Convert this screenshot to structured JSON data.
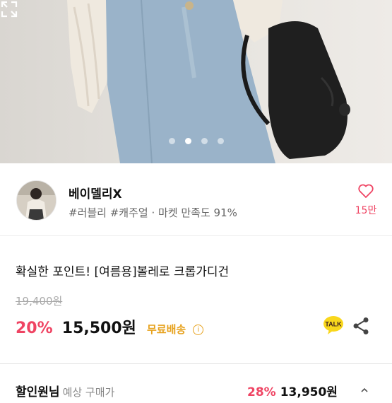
{
  "hero": {
    "dots_count": 4,
    "active_dot_index": 1,
    "expand_icon": "expand-icon"
  },
  "seller": {
    "name": "베이델리X",
    "tags": "#러블리 #캐주얼 · 마켓 만족도 91%",
    "like_icon": "heart-outline-icon",
    "like_count": "15만"
  },
  "product": {
    "title": "확실한 포인트! [여름용]볼레로 크롭가디건",
    "original_price": "19,400원",
    "discount": "20%",
    "price": "15,500원",
    "shipping_badge": "무료배송",
    "info_icon": "info-icon"
  },
  "actions": {
    "talk_label": "TALK",
    "share_icon": "share-icon"
  },
  "next_row": {
    "label": "할인원님",
    "sub": "예상 구매가",
    "discount": "28%",
    "price": "13,950원"
  },
  "colors": {
    "accent_pink": "#ef4463",
    "shipping_yellow": "#e7a21e",
    "kakao_yellow": "#f9d71c"
  }
}
